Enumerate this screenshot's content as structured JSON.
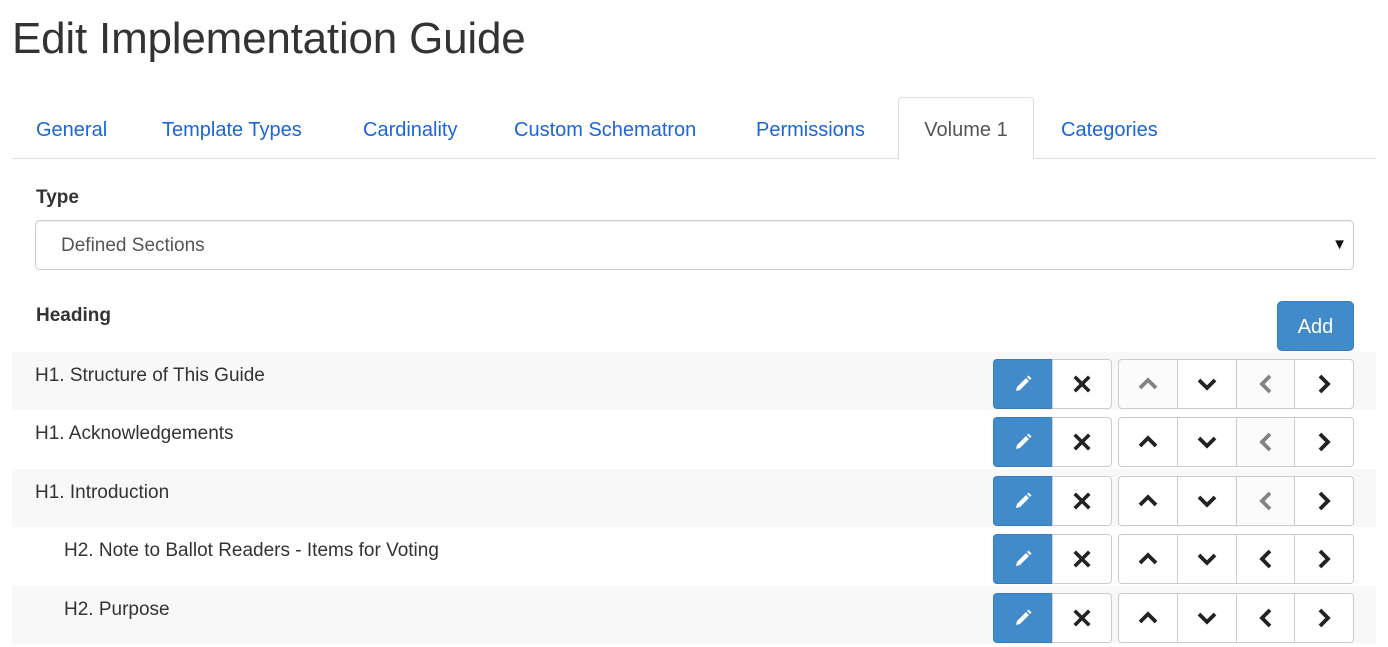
{
  "page": {
    "title": "Edit Implementation Guide"
  },
  "tabs": [
    {
      "label": "General",
      "active": false
    },
    {
      "label": "Template Types",
      "active": false
    },
    {
      "label": "Cardinality",
      "active": false
    },
    {
      "label": "Custom Schematron",
      "active": false
    },
    {
      "label": "Permissions",
      "active": false
    },
    {
      "label": "Volume 1",
      "active": true
    },
    {
      "label": "Categories",
      "active": false
    }
  ],
  "type_field": {
    "label": "Type",
    "value": "Defined Sections",
    "caret": "▼"
  },
  "heading_section": {
    "label": "Heading",
    "add_label": "Add"
  },
  "rows": [
    {
      "label": "H1. Structure of This Guide",
      "level": 1,
      "up_enabled": false,
      "down_enabled": true,
      "left_enabled": false,
      "right_enabled": true
    },
    {
      "label": "H1. Acknowledgements",
      "level": 1,
      "up_enabled": true,
      "down_enabled": true,
      "left_enabled": false,
      "right_enabled": true
    },
    {
      "label": "H1. Introduction",
      "level": 1,
      "up_enabled": true,
      "down_enabled": true,
      "left_enabled": false,
      "right_enabled": true
    },
    {
      "label": "H2. Note to Ballot Readers - Items for Voting",
      "level": 2,
      "up_enabled": true,
      "down_enabled": true,
      "left_enabled": true,
      "right_enabled": true
    },
    {
      "label": "H2. Purpose",
      "level": 2,
      "up_enabled": true,
      "down_enabled": true,
      "left_enabled": true,
      "right_enabled": true
    }
  ],
  "icons": {
    "edit": "pencil-icon",
    "delete": "close-icon",
    "up": "chevron-up-icon",
    "down": "chevron-down-icon",
    "left": "chevron-left-icon",
    "right": "chevron-right-icon"
  },
  "colors": {
    "primary": "#428bca",
    "link": "#1a66d6",
    "stripe": "#f8f8f8"
  }
}
